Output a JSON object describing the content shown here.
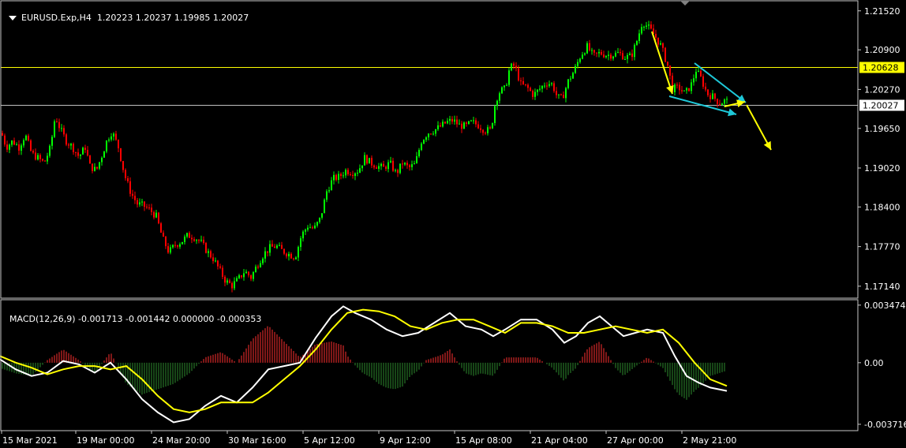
{
  "header": {
    "menu_icon": "triangle-down-icon",
    "symbol": "EURUSD.Exp,H4",
    "ohlc": "1.20223 1.20237 1.19985 1.20027"
  },
  "macd_header": {
    "label": "MACD(12,26,9) -0.001713 -0.001442 0.000000 -0.000353"
  },
  "colors": {
    "background": "#000000",
    "bull_candle": "#00ff00",
    "bear_candle": "#ff0000",
    "resistance_line": "#ffff00",
    "price_line": "#c0c0c0",
    "macd_main": "#ffffff",
    "macd_signal": "#ffff00",
    "hist_positive": "#ff3030",
    "hist_negative": "#2e8b2e",
    "arrow_yellow": "#ffff00",
    "arrow_cyan": "#1ec8d8",
    "axis_text": "#ffffff"
  },
  "chart_data": [
    {
      "type": "candlestick",
      "symbol": "EURUSD.Exp",
      "timeframe": "H4",
      "y_ticks": [
        "1.21520",
        "1.20900",
        "1.20270",
        "1.19650",
        "1.19020",
        "1.18400",
        "1.17770",
        "1.17140"
      ],
      "ylim": [
        1.1695,
        1.2168
      ],
      "x_ticks": [
        "15 Mar 2021",
        "19 Mar 00:00",
        "24 Mar 20:00",
        "30 Mar 16:00",
        "5 Apr 12:00",
        "9 Apr 12:00",
        "15 Apr 08:00",
        "21 Apr 04:00",
        "27 Apr 00:00",
        "2 May 21:00"
      ],
      "close_path": [
        [
          0,
          1.1965
        ],
        [
          8,
          1.1935
        ],
        [
          16,
          1.1945
        ],
        [
          24,
          1.1935
        ],
        [
          32,
          1.1955
        ],
        [
          40,
          1.1925
        ],
        [
          48,
          1.1918
        ],
        [
          56,
          1.191
        ],
        [
          64,
          1.1935
        ],
        [
          70,
          1.1985
        ],
        [
          76,
          1.1965
        ],
        [
          84,
          1.1945
        ],
        [
          92,
          1.1935
        ],
        [
          100,
          1.192
        ],
        [
          108,
          1.1935
        ],
        [
          114,
          1.1905
        ],
        [
          122,
          1.1898
        ],
        [
          130,
          1.1925
        ],
        [
          136,
          1.1948
        ],
        [
          142,
          1.196
        ],
        [
          150,
          1.1935
        ],
        [
          158,
          1.189
        ],
        [
          166,
          1.1862
        ],
        [
          174,
          1.1845
        ],
        [
          182,
          1.1842
        ],
        [
          190,
          1.1835
        ],
        [
          198,
          1.1825
        ],
        [
          206,
          1.179
        ],
        [
          214,
          1.1768
        ],
        [
          222,
          1.178
        ],
        [
          230,
          1.1785
        ],
        [
          238,
          1.1795
        ],
        [
          246,
          1.1792
        ],
        [
          254,
          1.1785
        ],
        [
          262,
          1.177
        ],
        [
          270,
          1.1758
        ],
        [
          278,
          1.174
        ],
        [
          286,
          1.1722
        ],
        [
          294,
          1.1715
        ],
        [
          302,
          1.1725
        ],
        [
          310,
          1.1738
        ],
        [
          318,
          1.1728
        ],
        [
          326,
          1.1748
        ],
        [
          334,
          1.1765
        ],
        [
          342,
          1.1775
        ],
        [
          350,
          1.1778
        ],
        [
          358,
          1.177
        ],
        [
          366,
          1.1765
        ],
        [
          374,
          1.176
        ],
        [
          382,
          1.1795
        ],
        [
          390,
          1.181
        ],
        [
          398,
          1.1805
        ],
        [
          406,
          1.1822
        ],
        [
          414,
          1.1865
        ],
        [
          422,
          1.1885
        ],
        [
          430,
          1.1888
        ],
        [
          438,
          1.1898
        ],
        [
          446,
          1.1895
        ],
        [
          454,
          1.1898
        ],
        [
          462,
          1.1918
        ],
        [
          470,
          1.191
        ],
        [
          478,
          1.1905
        ],
        [
          486,
          1.1902
        ],
        [
          494,
          1.191
        ],
        [
          502,
          1.1893
        ],
        [
          510,
          1.191
        ],
        [
          518,
          1.1902
        ],
        [
          526,
          1.1908
        ],
        [
          534,
          1.1945
        ],
        [
          542,
          1.1958
        ],
        [
          550,
          1.1962
        ],
        [
          558,
          1.1968
        ],
        [
          566,
          1.1975
        ],
        [
          574,
          1.1978
        ],
        [
          582,
          1.197
        ],
        [
          590,
          1.1968
        ],
        [
          598,
          1.1975
        ],
        [
          606,
          1.197
        ],
        [
          614,
          1.1962
        ],
        [
          622,
          1.1962
        ],
        [
          628,
          1.201
        ],
        [
          634,
          1.2025
        ],
        [
          640,
          1.2028
        ],
        [
          646,
          1.2062
        ],
        [
          652,
          1.2065
        ],
        [
          660,
          1.2035
        ],
        [
          668,
          1.203
        ],
        [
          676,
          1.2018
        ],
        [
          684,
          1.2028
        ],
        [
          692,
          1.2038
        ],
        [
          700,
          1.2035
        ],
        [
          706,
          1.2015
        ],
        [
          712,
          1.2012
        ],
        [
          720,
          1.204
        ],
        [
          728,
          1.2058
        ],
        [
          736,
          1.2082
        ],
        [
          744,
          1.2095
        ],
        [
          752,
          1.208
        ],
        [
          760,
          1.2085
        ],
        [
          768,
          1.2082
        ],
        [
          776,
          1.2082
        ],
        [
          784,
          1.2085
        ],
        [
          792,
          1.2078
        ],
        [
          800,
          1.208
        ],
        [
          808,
          1.2108
        ],
        [
          814,
          1.2135
        ],
        [
          822,
          1.2125
        ],
        [
          830,
          1.2112
        ],
        [
          838,
          1.2095
        ],
        [
          846,
          1.2065
        ],
        [
          852,
          1.2028
        ],
        [
          860,
          1.203
        ],
        [
          868,
          1.202
        ],
        [
          876,
          1.2035
        ],
        [
          882,
          1.2058
        ],
        [
          888,
          1.2045
        ],
        [
          896,
          1.202
        ],
        [
          904,
          1.2015
        ],
        [
          912,
          1.2005
        ],
        [
          920,
          1.201
        ],
        [
          924,
          1.2003
        ]
      ],
      "horizontal_levels": [
        {
          "value": "1.20628",
          "color": "#ffff00",
          "role": "resistance-line"
        },
        {
          "value": "1.20027",
          "color": "#c0c0c0",
          "role": "current-price-line"
        }
      ]
    },
    {
      "type": "line",
      "name": "MACD(12,26,9)",
      "y_ticks": [
        "0.003474",
        "0.00",
        "-0.003716"
      ],
      "ylim": [
        -0.0041,
        0.0038
      ],
      "series": [
        {
          "name": "main",
          "color": "#ffffff",
          "points": [
            [
              0,
              0.0002
            ],
            [
              20,
              -0.0004
            ],
            [
              40,
              -0.0008
            ],
            [
              60,
              -0.0006
            ],
            [
              80,
              0.0001
            ],
            [
              100,
              -0.0001
            ],
            [
              120,
              -0.0006
            ],
            [
              140,
              0.0
            ],
            [
              160,
              -0.001
            ],
            [
              180,
              -0.0022
            ],
            [
              200,
              -0.003
            ],
            [
              220,
              -0.0036
            ],
            [
              240,
              -0.0034
            ],
            [
              260,
              -0.0026
            ],
            [
              280,
              -0.002
            ],
            [
              300,
              -0.0024
            ],
            [
              320,
              -0.0015
            ],
            [
              340,
              -0.0004
            ],
            [
              360,
              -0.0002
            ],
            [
              380,
              0.0
            ],
            [
              400,
              0.0015
            ],
            [
              420,
              0.0028
            ],
            [
              435,
              0.0034
            ],
            [
              450,
              0.003
            ],
            [
              470,
              0.0026
            ],
            [
              490,
              0.002
            ],
            [
              510,
              0.0016
            ],
            [
              530,
              0.0018
            ],
            [
              550,
              0.0024
            ],
            [
              570,
              0.003
            ],
            [
              590,
              0.0022
            ],
            [
              610,
              0.002
            ],
            [
              625,
              0.0016
            ],
            [
              640,
              0.002
            ],
            [
              660,
              0.0026
            ],
            [
              680,
              0.0026
            ],
            [
              700,
              0.002
            ],
            [
              715,
              0.0012
            ],
            [
              730,
              0.0016
            ],
            [
              745,
              0.0024
            ],
            [
              760,
              0.0028
            ],
            [
              775,
              0.0022
            ],
            [
              790,
              0.0016
            ],
            [
              805,
              0.0018
            ],
            [
              820,
              0.002
            ],
            [
              840,
              0.0018
            ],
            [
              855,
              0.0004
            ],
            [
              870,
              -0.0008
            ],
            [
              885,
              -0.0012
            ],
            [
              900,
              -0.0015
            ],
            [
              921,
              -0.0017
            ]
          ]
        },
        {
          "name": "signal",
          "color": "#ffff00",
          "points": [
            [
              0,
              0.0004
            ],
            [
              20,
              0.0
            ],
            [
              40,
              -0.0003
            ],
            [
              60,
              -0.0007
            ],
            [
              80,
              -0.0004
            ],
            [
              100,
              -0.0002
            ],
            [
              120,
              -0.0002
            ],
            [
              140,
              -0.0004
            ],
            [
              160,
              -0.0002
            ],
            [
              180,
              -0.001
            ],
            [
              200,
              -0.002
            ],
            [
              220,
              -0.0028
            ],
            [
              240,
              -0.003
            ],
            [
              260,
              -0.0028
            ],
            [
              280,
              -0.0024
            ],
            [
              300,
              -0.0024
            ],
            [
              320,
              -0.0024
            ],
            [
              340,
              -0.0018
            ],
            [
              360,
              -0.001
            ],
            [
              380,
              -0.0002
            ],
            [
              400,
              0.0008
            ],
            [
              420,
              0.002
            ],
            [
              440,
              0.003
            ],
            [
              460,
              0.0032
            ],
            [
              480,
              0.0031
            ],
            [
              500,
              0.0028
            ],
            [
              520,
              0.0022
            ],
            [
              540,
              0.002
            ],
            [
              560,
              0.0024
            ],
            [
              580,
              0.0026
            ],
            [
              600,
              0.0026
            ],
            [
              620,
              0.0022
            ],
            [
              640,
              0.0018
            ],
            [
              660,
              0.0024
            ],
            [
              680,
              0.0024
            ],
            [
              700,
              0.0022
            ],
            [
              720,
              0.0018
            ],
            [
              740,
              0.0018
            ],
            [
              760,
              0.002
            ],
            [
              780,
              0.0022
            ],
            [
              800,
              0.002
            ],
            [
              820,
              0.0018
            ],
            [
              840,
              0.002
            ],
            [
              860,
              0.0012
            ],
            [
              880,
              0.0
            ],
            [
              900,
              -0.001
            ],
            [
              921,
              -0.0014
            ]
          ]
        }
      ]
    }
  ]
}
